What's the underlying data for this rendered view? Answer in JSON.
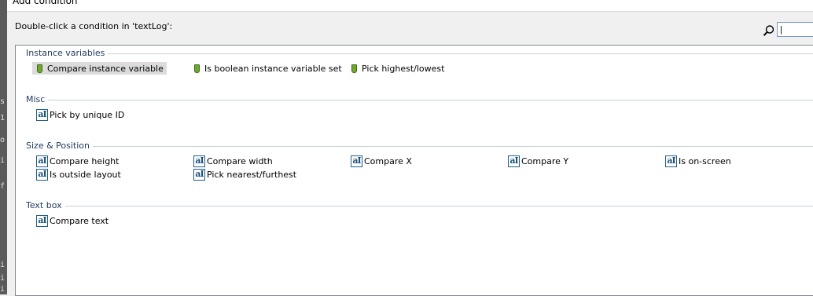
{
  "window": {
    "title": "Add condition"
  },
  "instruction": "Double-click a condition in 'textLog':",
  "search": {
    "value": "|"
  },
  "left_strip_glyphs": [
    "s",
    "1",
    "o",
    "i",
    "f",
    "i",
    "i",
    "i"
  ],
  "groups": [
    {
      "label": "Instance variables",
      "items": [
        {
          "label": "Compare instance variable",
          "icon": "pin-icon",
          "selected": true
        },
        {
          "label": "Is boolean instance variable set",
          "icon": "pin-icon"
        },
        {
          "label": "Pick highest/lowest",
          "icon": "pin-icon"
        }
      ]
    },
    {
      "label": "Misc",
      "items": [
        {
          "label": "Pick by unique ID",
          "icon": "text-object-icon"
        }
      ]
    },
    {
      "label": "Size & Position",
      "items": [
        {
          "label": "Compare height",
          "icon": "text-object-icon"
        },
        {
          "label": "Compare width",
          "icon": "text-object-icon"
        },
        {
          "label": "Compare X",
          "icon": "text-object-icon"
        },
        {
          "label": "Compare Y",
          "icon": "text-object-icon"
        },
        {
          "label": "Is on-screen",
          "icon": "text-object-icon"
        },
        {
          "label": "Is outside layout",
          "icon": "text-object-icon"
        },
        {
          "label": "Pick nearest/furthest",
          "icon": "text-object-icon"
        }
      ]
    },
    {
      "label": "Text box",
      "items": [
        {
          "label": "Compare text",
          "icon": "text-object-icon"
        }
      ]
    }
  ],
  "icon_glyph": "aI",
  "colors": {
    "group_label": "#1e395b",
    "selection": "#dcdcdc",
    "pin": "#6fa82e"
  }
}
